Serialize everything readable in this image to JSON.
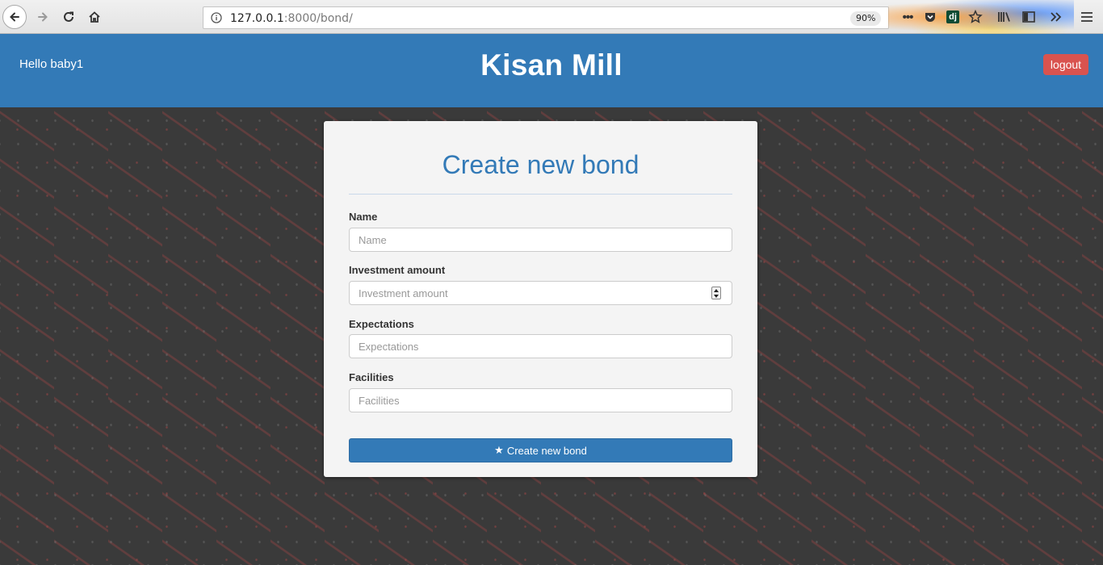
{
  "browser": {
    "url_host": "127.0.0.1",
    "url_rest": ":8000/bond/",
    "zoom": "90%",
    "more_icon": "•••",
    "dj_label": "dj"
  },
  "header": {
    "greeting": "Hello baby1",
    "brand": "Kisan Mill",
    "logout_label": "logout",
    "brand_color": "#337ab7",
    "logout_color": "#d9534f"
  },
  "form": {
    "title": "Create new bond",
    "fields": [
      {
        "label": "Name",
        "placeholder": "Name"
      },
      {
        "label": "Investment amount",
        "placeholder": "Investment amount"
      },
      {
        "label": "Expectations",
        "placeholder": "Expectations"
      },
      {
        "label": "Facilities",
        "placeholder": "Facilities"
      }
    ],
    "submit_icon": "★",
    "submit_label": "Create new bond"
  }
}
